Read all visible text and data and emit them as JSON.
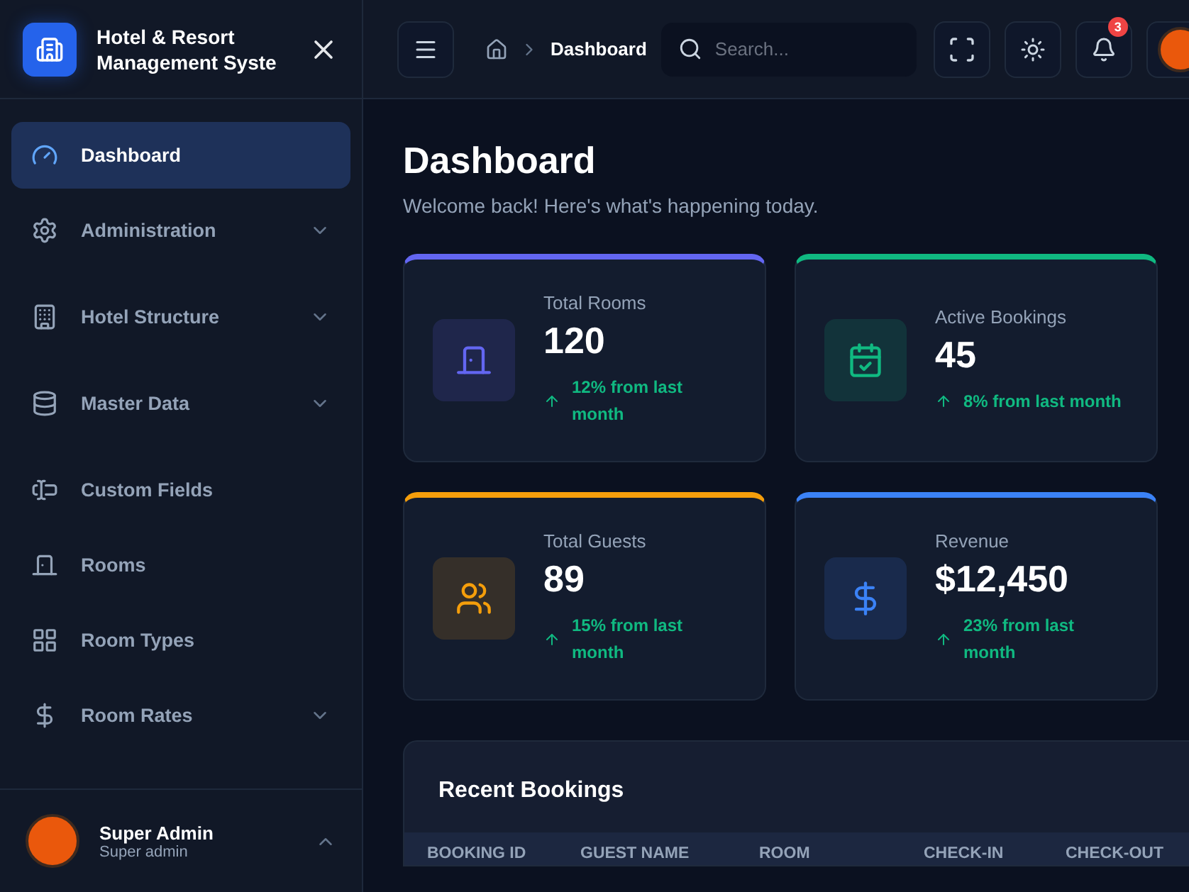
{
  "brand": {
    "title_line_1": "Hotel & Resort",
    "title_line_2": "Management Syste"
  },
  "sidebar": {
    "items": [
      {
        "label": "Dashboard",
        "kind": "link",
        "selected": true
      },
      {
        "label": "Administration",
        "kind": "group",
        "selected": false
      },
      {
        "label": "Hotel Structure",
        "kind": "group",
        "selected": false
      },
      {
        "label": "Master Data",
        "kind": "group",
        "selected": false
      },
      {
        "label": "Custom Fields",
        "kind": "link",
        "selected": false
      },
      {
        "label": "Rooms",
        "kind": "link",
        "selected": false
      },
      {
        "label": "Room Types",
        "kind": "link",
        "selected": false
      },
      {
        "label": "Room Rates",
        "kind": "group",
        "selected": false
      }
    ],
    "user": {
      "name": "Super Admin",
      "role": "Super admin"
    }
  },
  "header": {
    "breadcrumb": "Dashboard",
    "search": {
      "placeholder": "Search..."
    },
    "notifications": "3"
  },
  "page": {
    "title": "Dashboard",
    "subtitle": "Welcome back! Here's what's happening today."
  },
  "stats": [
    {
      "label": "Total Rooms",
      "value": "120",
      "change": "12% from last month",
      "color": "#6366f1"
    },
    {
      "label": "Active Bookings",
      "value": "45",
      "change": "8% from last month",
      "color": "#10b981"
    },
    {
      "label": "Total Guests",
      "value": "89",
      "change": "15% from last month",
      "color": "#f59e0b"
    },
    {
      "label": "Revenue",
      "value": "$12,450",
      "change": "23% from last month",
      "color": "#3b82f6"
    }
  ],
  "recent_bookings": {
    "title": "Recent Bookings",
    "columns": [
      "BOOKING ID",
      "GUEST NAME",
      "ROOM",
      "CHECK-IN",
      "CHECK-OUT"
    ]
  }
}
